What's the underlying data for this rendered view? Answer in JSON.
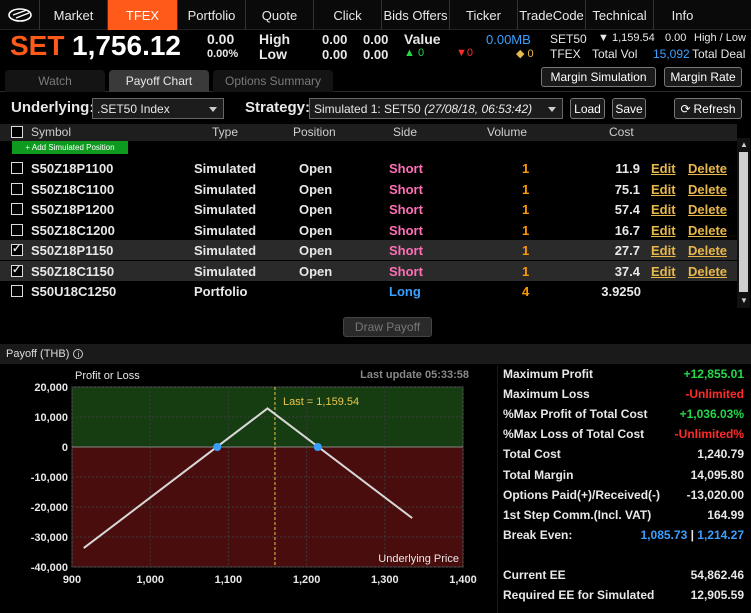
{
  "nav": {
    "logo_icon": "brand-logo-icon",
    "items": [
      "Market",
      "TFEX",
      "Portfolio",
      "Quote",
      "Click",
      "Bids Offers",
      "Ticker",
      "TradeCode",
      "Technical",
      "Info"
    ],
    "active": "TFEX"
  },
  "ticker": {
    "symbol": "SET",
    "price": "1,756.12",
    "change": "0.00",
    "pct": "0.00%",
    "high_label": "High",
    "low_label": "Low",
    "high1": "0.00",
    "high2": "0.00",
    "low1": "0.00",
    "low2": "0.00",
    "value_label": "Value",
    "value": "0.00MB",
    "up_count": "0",
    "down_count": "0",
    "unch_count": "0",
    "set50_label": "SET50",
    "set50_price": "1,159.54",
    "set50_change": "0.00",
    "hl_label": "High / Low",
    "tfex_label": "TFEX",
    "total_vol_label": "Total Vol",
    "total_vol": "15,092",
    "total_deal_label": "Total Deal"
  },
  "subtabs": [
    "Watch",
    "Payoff Chart",
    "Options Summary"
  ],
  "buttons": {
    "margin_sim": "Margin Simulation",
    "margin_rate": "Margin Rate",
    "load": "Load",
    "save": "Save",
    "refresh": "Refresh",
    "draw_payoff": "Draw Payoff",
    "add_sim": "+ Add Simulated Position"
  },
  "controls": {
    "underlying_label": "Underlying:",
    "underlying_value": ".SET50 Index",
    "strategy_label": "Strategy:",
    "strategy_value": "Simulated 1: SET50",
    "strategy_time": "(27/08/18, 06:53:42)"
  },
  "table": {
    "headers": [
      "Symbol",
      "Type",
      "Position",
      "Side",
      "Volume",
      "Cost"
    ],
    "rows": [
      {
        "checked": false,
        "symbol": "S50Z18P1100",
        "type": "Simulated",
        "position": "Open",
        "side": "Short",
        "volume": "1",
        "cost": "11.9",
        "edit": "Edit",
        "delete": "Delete"
      },
      {
        "checked": false,
        "symbol": "S50Z18C1100",
        "type": "Simulated",
        "position": "Open",
        "side": "Short",
        "volume": "1",
        "cost": "75.1",
        "edit": "Edit",
        "delete": "Delete"
      },
      {
        "checked": false,
        "symbol": "S50Z18P1200",
        "type": "Simulated",
        "position": "Open",
        "side": "Short",
        "volume": "1",
        "cost": "57.4",
        "edit": "Edit",
        "delete": "Delete"
      },
      {
        "checked": false,
        "symbol": "S50Z18C1200",
        "type": "Simulated",
        "position": "Open",
        "side": "Short",
        "volume": "1",
        "cost": "16.7",
        "edit": "Edit",
        "delete": "Delete"
      },
      {
        "checked": true,
        "symbol": "S50Z18P1150",
        "type": "Simulated",
        "position": "Open",
        "side": "Short",
        "volume": "1",
        "cost": "27.7",
        "edit": "Edit",
        "delete": "Delete"
      },
      {
        "checked": true,
        "symbol": "S50Z18C1150",
        "type": "Simulated",
        "position": "Open",
        "side": "Short",
        "volume": "1",
        "cost": "37.4",
        "edit": "Edit",
        "delete": "Delete"
      },
      {
        "checked": false,
        "symbol": "S50U18C1250",
        "type": "Portfolio",
        "position": "",
        "side": "Long",
        "volume": "4",
        "cost": "3.9250",
        "edit": "",
        "delete": ""
      }
    ]
  },
  "payoff": {
    "header": "Payoff (THB)",
    "info_icon": "info-icon",
    "last_update": "Last update 05:33:58"
  },
  "chart_data": {
    "type": "line",
    "ylabel": "Profit or Loss",
    "xlabel": "Underlying Price",
    "xlim": [
      900,
      1400
    ],
    "ylim": [
      -40000,
      20000
    ],
    "xticks": [
      "900",
      "1,000",
      "1,100",
      "1,200",
      "1,300",
      "1,400"
    ],
    "yticks": [
      "20,000",
      "10,000",
      "0",
      "-10,000",
      "-20,000",
      "-30,000",
      "-40,000"
    ],
    "x": [
      915,
      1150,
      1335
    ],
    "y": [
      -33700,
      12855,
      -23700
    ],
    "break_even": [
      1085.73,
      1214.27
    ],
    "last_value": 1159.54,
    "last_label": "Last = 1,159.54",
    "colors": {
      "profit_zone": "#163d11",
      "loss_zone": "#4a0d0d",
      "line": "#d8d8d8",
      "marker": "#3aa0ff",
      "last": "#e8c64a"
    }
  },
  "stats": [
    {
      "label": "Maximum Profit",
      "value": "+12,855.01",
      "color": "green"
    },
    {
      "label": "Maximum Loss",
      "value": "-Unlimited",
      "color": "red"
    },
    {
      "label": "%Max Profit of Total Cost",
      "value": "+1,036.03%",
      "color": "green"
    },
    {
      "label": "%Max Loss of Total Cost",
      "value": "-Unlimited%",
      "color": "red"
    },
    {
      "label": "Total Cost",
      "value": "1,240.79",
      "color": "white"
    },
    {
      "label": "Total Margin",
      "value": "14,095.80",
      "color": "white"
    },
    {
      "label": "Options Paid(+)/Received(-)",
      "value": "-13,020.00",
      "color": "white"
    },
    {
      "label": "1st Step Comm.(Incl. VAT)",
      "value": "164.99",
      "color": "white"
    },
    {
      "label": "Break Even:",
      "value": "1,085.73",
      "value2": "1,214.27",
      "color": "blue"
    },
    {
      "label": "Current EE",
      "value": "54,862.46",
      "color": "white"
    },
    {
      "label": "Required EE for Simulated",
      "value": "12,905.59",
      "color": "white"
    }
  ]
}
